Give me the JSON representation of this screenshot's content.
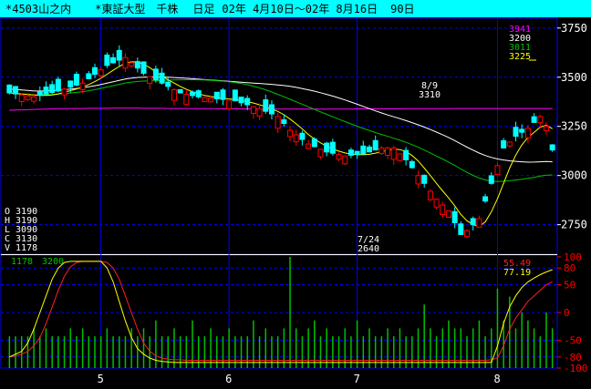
{
  "header": {
    "stock": "*4503山之内",
    "index": "*東証大型",
    "unit": "千株",
    "period": "日足",
    "range": "02年 4月10日～02年 8月16日",
    "bars": "90日"
  },
  "price_legend": [
    "3941",
    "3200",
    "3011",
    "3225"
  ],
  "ohlcv": [
    "O 3190",
    "H 3190",
    "L 3090",
    "C 3130",
    "V 1178"
  ],
  "volume_label": "1178",
  "volume_scale_label": "3200",
  "osc_legend": [
    "55.49",
    "77.19"
  ],
  "annotations": [
    {
      "date": "8/9",
      "value": "3310"
    },
    {
      "date": "7/24",
      "value": "2640"
    }
  ],
  "colors": {
    "header_bg": "#00ffff",
    "grid": "#0000ff",
    "up": "#ff0000",
    "down": "#00ffff",
    "ma_short": "#ffff00",
    "ma_mid": "#00c000",
    "ma_long": "#ffffff",
    "ma_extra": "#ff00ff",
    "volume": "#00c000"
  },
  "chart_data": [
    {
      "type": "candlestick",
      "title": "",
      "y_ticks": [
        3750,
        3500,
        3250,
        3000,
        2750
      ],
      "ylim": [
        2600,
        3800
      ],
      "x_ticks": [
        {
          "label": "5",
          "index": 15
        },
        {
          "label": "6",
          "index": 36
        },
        {
          "label": "7",
          "index": 57
        },
        {
          "label": "8",
          "index": 80
        }
      ],
      "series": [
        {
          "name": "3941",
          "type": "line",
          "values": [
            3332,
            3333,
            3334,
            3335,
            3336,
            3337,
            3338,
            3339,
            3340,
            3340,
            3341,
            3341,
            3341,
            3342,
            3342,
            3342,
            3342,
            3343,
            3343,
            3343,
            3343,
            3343,
            3342,
            3342,
            3342,
            3342,
            3341,
            3341,
            3341,
            3341,
            3340,
            3340,
            3340,
            3340,
            3340,
            3339,
            3339,
            3339,
            3339,
            3339,
            3338,
            3338,
            3338,
            3338,
            3338,
            3338,
            3338,
            3338,
            3338,
            3338,
            3338,
            3338,
            3338,
            3338,
            3338,
            3338,
            3338,
            3339,
            3339,
            3339,
            3339,
            3339,
            3339,
            3339,
            3339,
            3340,
            3340,
            3340,
            3340,
            3340,
            3340,
            3340,
            3340,
            3341,
            3341,
            3341,
            3341,
            3341,
            3341,
            3341,
            3341,
            3341,
            3341,
            3341,
            3341,
            3341,
            3341,
            3341,
            3341,
            3341
          ]
        }
      ]
    },
    {
      "type": "bar",
      "title": "Volume",
      "values": [
        4,
        4,
        4,
        4,
        5,
        4,
        5,
        4,
        4,
        4,
        5,
        4,
        5,
        4,
        4,
        4,
        5,
        4,
        4,
        4,
        5,
        4,
        5,
        4,
        6,
        4,
        4,
        5,
        4,
        4,
        6,
        4,
        4,
        5,
        4,
        4,
        5,
        4,
        4,
        4,
        6,
        4,
        5,
        4,
        4,
        5,
        14,
        5,
        4,
        5,
        6,
        4,
        5,
        4,
        4,
        5,
        4,
        6,
        4,
        5,
        4,
        4,
        5,
        4,
        5,
        4,
        4,
        5,
        8,
        5,
        4,
        5,
        6,
        5,
        5,
        4,
        5,
        6,
        4,
        5,
        10,
        6,
        9,
        5,
        7,
        6,
        5,
        4,
        7,
        5
      ]
    },
    {
      "type": "line",
      "title": "Oscillator",
      "y_ticks": [
        100,
        80,
        50,
        0,
        -50,
        -80,
        -100
      ],
      "ylim": [
        -100,
        100
      ],
      "series": [
        {
          "name": "55.49",
          "values": [
            -80,
            -78,
            -75,
            -70,
            -60,
            -45,
            -20,
            10,
            40,
            65,
            82,
            90,
            92,
            92,
            92,
            92,
            90,
            80,
            60,
            30,
            0,
            -30,
            -55,
            -70,
            -78,
            -82,
            -84,
            -85,
            -85,
            -86,
            -86,
            -86,
            -86,
            -86,
            -86,
            -86,
            -86,
            -86,
            -86,
            -86,
            -86,
            -86,
            -86,
            -86,
            -86,
            -86,
            -86,
            -86,
            -86,
            -86,
            -86,
            -86,
            -86,
            -86,
            -86,
            -86,
            -86,
            -86,
            -86,
            -86,
            -86,
            -86,
            -86,
            -86,
            -86,
            -86,
            -86,
            -86,
            -86,
            -86,
            -86,
            -86,
            -86,
            -86,
            -86,
            -86,
            -86,
            -86,
            -86,
            -85,
            -82,
            -60,
            -30,
            -10,
            5,
            20,
            30,
            40,
            50,
            55
          ]
        },
        {
          "name": "77.19",
          "values": [
            -80,
            -75,
            -70,
            -55,
            -30,
            0,
            30,
            60,
            80,
            90,
            92,
            92,
            92,
            92,
            92,
            92,
            80,
            55,
            20,
            -15,
            -45,
            -65,
            -75,
            -82,
            -86,
            -88,
            -89,
            -90,
            -90,
            -90,
            -90,
            -90,
            -90,
            -90,
            -90,
            -90,
            -90,
            -90,
            -90,
            -90,
            -90,
            -90,
            -90,
            -90,
            -90,
            -90,
            -90,
            -90,
            -90,
            -90,
            -90,
            -90,
            -90,
            -90,
            -90,
            -90,
            -90,
            -90,
            -90,
            -90,
            -90,
            -90,
            -90,
            -90,
            -90,
            -90,
            -90,
            -90,
            -90,
            -90,
            -90,
            -90,
            -90,
            -90,
            -90,
            -90,
            -90,
            -90,
            -90,
            -90,
            -60,
            -20,
            10,
            30,
            45,
            55,
            62,
            68,
            73,
            77
          ]
        }
      ]
    }
  ]
}
